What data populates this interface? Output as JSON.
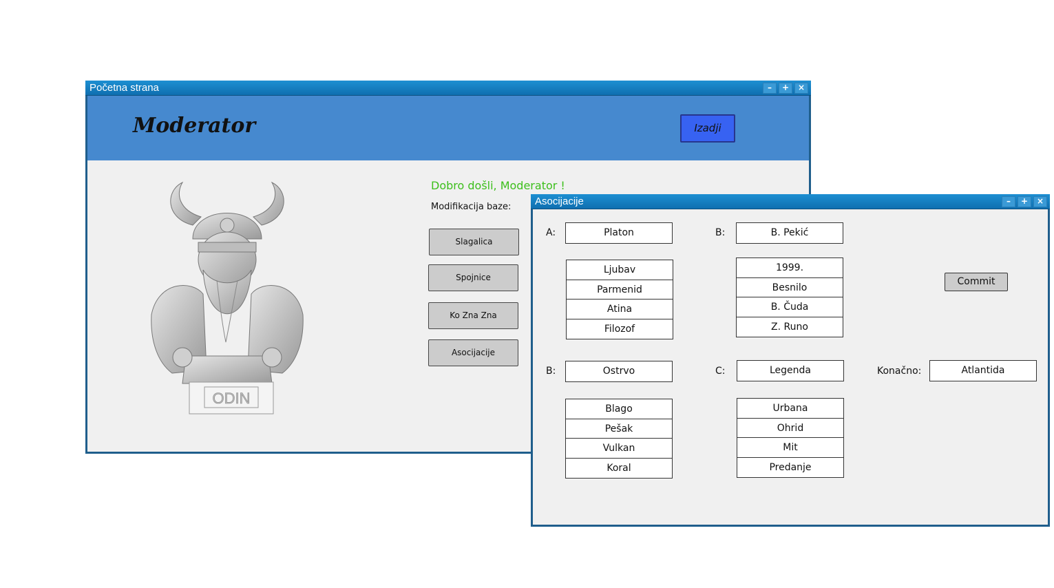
{
  "main_window": {
    "title": "Početna strana",
    "controls": [
      "–",
      "+",
      "×"
    ],
    "header_title": "Moderator",
    "exit_label": "Izadji",
    "welcome": "Dobro došli, Moderator !",
    "mod_label": "Modifikacija baze:",
    "menu": [
      "Slagalica",
      "Spojnice",
      "Ko Zna Zna",
      "Asocijacije"
    ],
    "bust_caption": "ODIN"
  },
  "assoc_window": {
    "title": "Asocijacije",
    "controls": [
      "–",
      "+",
      "×"
    ],
    "col_a": {
      "label": "A:",
      "answer": "Platon",
      "clues": [
        "Ljubav",
        "Parmenid",
        "Atina",
        "Filozof"
      ]
    },
    "col_b_top": {
      "label": "B:",
      "answer": "B. Pekić",
      "clues": [
        "1999.",
        "Besnilo",
        "B. Čuda",
        "Z. Runo"
      ]
    },
    "col_b_bottom": {
      "label": "B:",
      "answer": "Ostrvo",
      "clues": [
        "Blago",
        "Pešak",
        "Vulkan",
        "Koral"
      ]
    },
    "col_c": {
      "label": "C:",
      "answer": "Legenda",
      "clues": [
        "Urbana",
        "Ohrid",
        "Mit",
        "Predanje"
      ]
    },
    "final_label": "Konačno:",
    "final_answer": "Atlantida",
    "commit_label": "Commit"
  }
}
